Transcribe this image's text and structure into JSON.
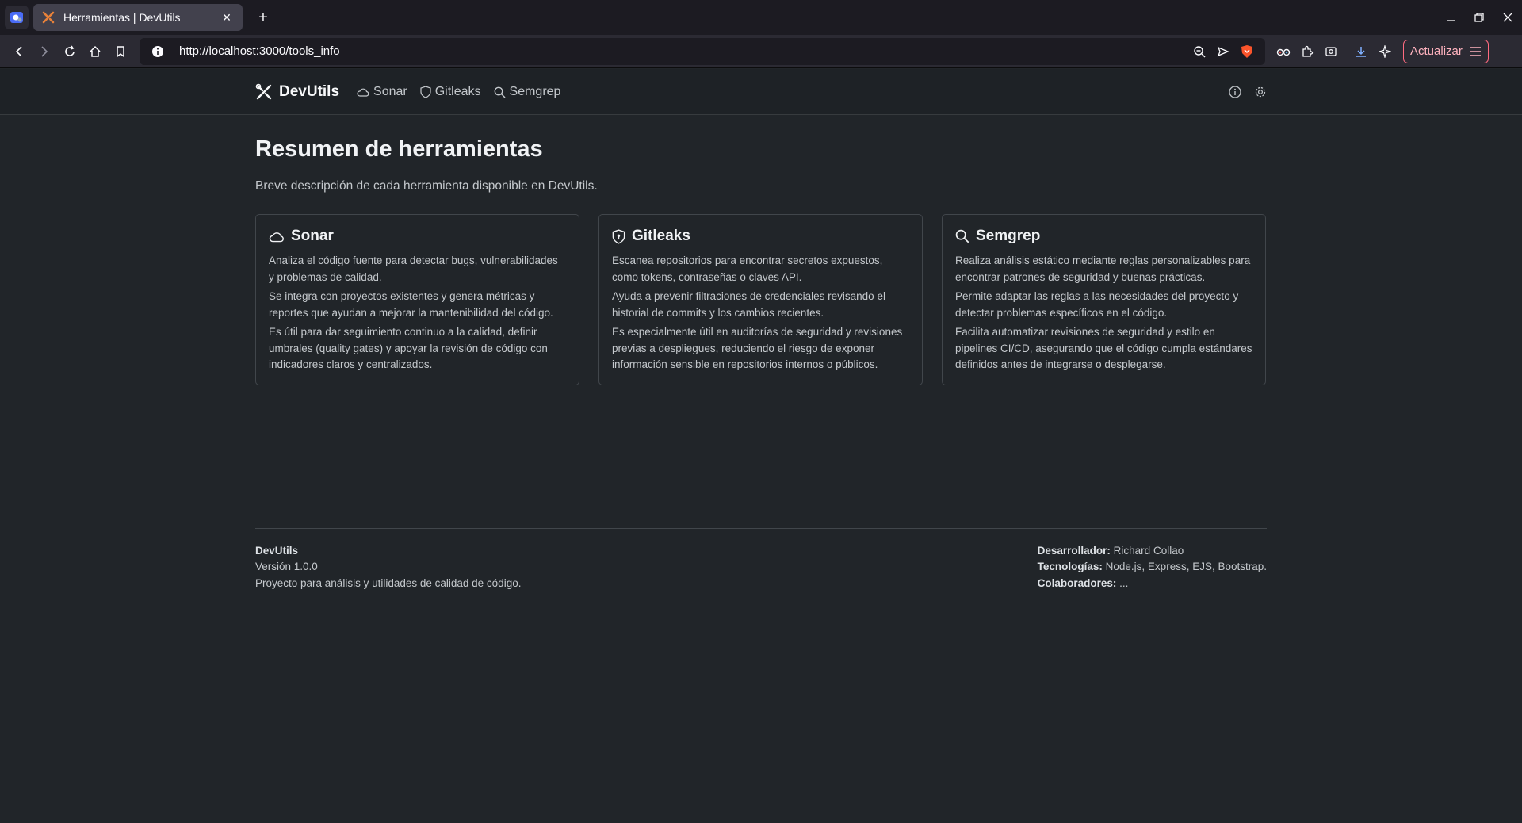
{
  "browser": {
    "tab_title": "Herramientas | DevUtils",
    "url": "http://localhost:3000/tools_info",
    "update_label": "Actualizar"
  },
  "app": {
    "brand": "DevUtils",
    "nav": [
      {
        "label": "Sonar",
        "icon": "cloud-icon"
      },
      {
        "label": "Gitleaks",
        "icon": "shield-icon"
      },
      {
        "label": "Semgrep",
        "icon": "search-icon"
      }
    ]
  },
  "main": {
    "title": "Resumen de herramientas",
    "lead": "Breve descripción de cada herramienta disponible en DevUtils.",
    "cards": [
      {
        "title": "Sonar",
        "icon": "cloud-icon",
        "paragraphs": [
          "Analiza el código fuente para detectar bugs, vulnerabilidades y problemas de calidad.",
          "Se integra con proyectos existentes y genera métricas y reportes que ayudan a mejorar la mantenibilidad del código.",
          "Es útil para dar seguimiento continuo a la calidad, definir umbrales (quality gates) y apoyar la revisión de código con indicadores claros y centralizados."
        ]
      },
      {
        "title": "Gitleaks",
        "icon": "shield-icon",
        "paragraphs": [
          "Escanea repositorios para encontrar secretos expuestos, como tokens, contraseñas o claves API.",
          "Ayuda a prevenir filtraciones de credenciales revisando el historial de commits y los cambios recientes.",
          "Es especialmente útil en auditorías de seguridad y revisiones previas a despliegues, reduciendo el riesgo de exponer información sensible en repositorios internos o públicos."
        ]
      },
      {
        "title": "Semgrep",
        "icon": "search-icon",
        "paragraphs": [
          "Realiza análisis estático mediante reglas personalizables para encontrar patrones de seguridad y buenas prácticas.",
          "Permite adaptar las reglas a las necesidades del proyecto y detectar problemas específicos en el código.",
          "Facilita automatizar revisiones de seguridad y estilo en pipelines CI/CD, asegurando que el código cumpla estándares definidos antes de integrarse o desplegarse."
        ]
      }
    ]
  },
  "footer": {
    "left": {
      "name": "DevUtils",
      "version": "Versión 1.0.0",
      "description": "Proyecto para análisis y utilidades de calidad de código."
    },
    "right": {
      "dev_label": "Desarrollador:",
      "dev_value": "Richard Collao",
      "tech_label": "Tecnologías:",
      "tech_value": "Node.js, Express, EJS, Bootstrap.",
      "collab_label": "Colaboradores:",
      "collab_value": "..."
    }
  }
}
